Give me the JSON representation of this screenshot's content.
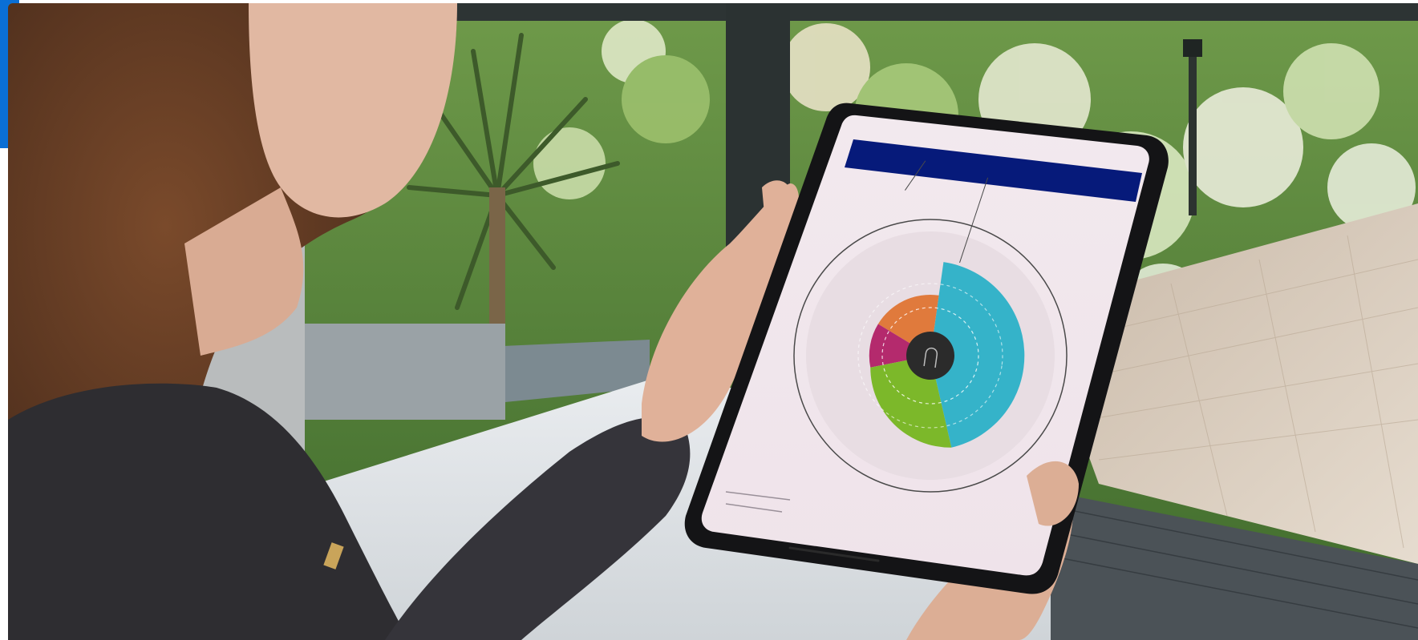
{
  "photo": {
    "description_icon": "photo-icon",
    "colors": {
      "accent": "#0a6fd6",
      "app_header": "#061a7a",
      "segment_teal": "#35b3c9",
      "segment_orange": "#e07a3c",
      "segment_magenta": "#b42a6d",
      "segment_green": "#7cb82a",
      "center": "#2b2b2b"
    }
  },
  "tablet": {
    "header_title": "",
    "footer_lines": []
  }
}
